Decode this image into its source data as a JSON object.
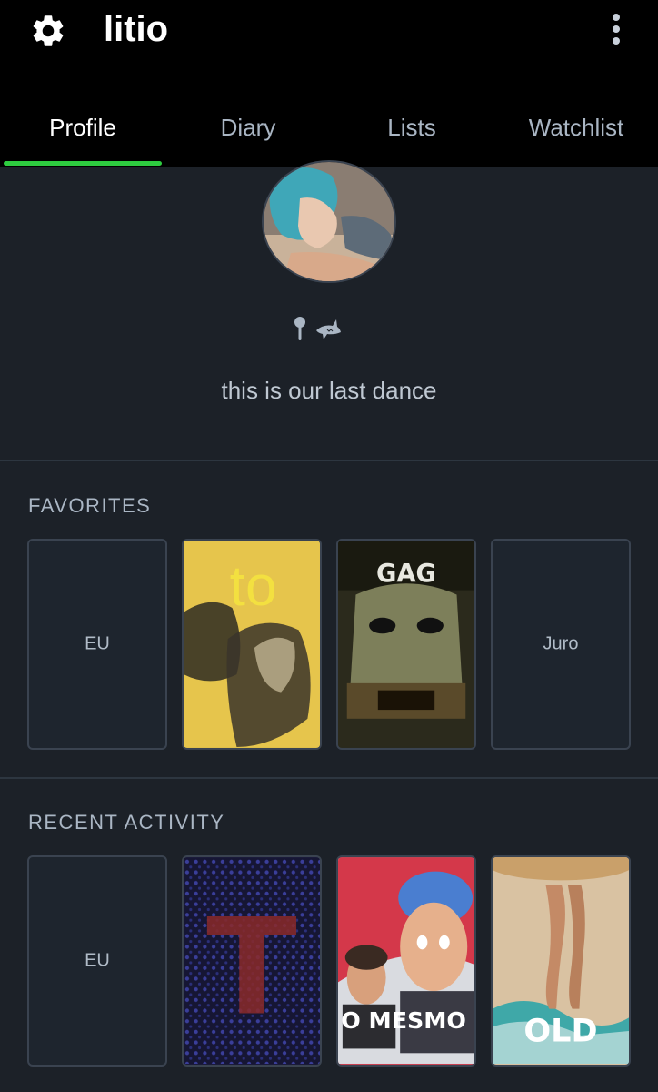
{
  "header": {
    "title": "litio",
    "settings_icon": "gear-icon",
    "menu_icon": "more-vert-icon"
  },
  "tabs": [
    {
      "label": "Profile",
      "active": true
    },
    {
      "label": "Diary",
      "active": false
    },
    {
      "label": "Lists",
      "active": false
    },
    {
      "label": "Watchlist",
      "active": false
    }
  ],
  "profile": {
    "avatar_icon": "avatar",
    "location_icon": "location-pin-icon",
    "emoji_icon": "shark-icon",
    "bio": "this is our last dance"
  },
  "favorites": {
    "title": "FAVORITES",
    "items": [
      {
        "label": "EU"
      },
      {
        "poster_text": "to"
      },
      {
        "poster_text": "GAG"
      },
      {
        "label": "Juro"
      }
    ]
  },
  "recent_activity": {
    "title": "RECENT ACTIVITY",
    "items": [
      {
        "label": "EU"
      },
      {
        "poster_text": "T"
      },
      {
        "poster_text": "O MESMO"
      },
      {
        "poster_text": "OLD"
      }
    ]
  },
  "colors": {
    "background": "#1c2128",
    "header": "#000000",
    "accent": "#2ecc40",
    "text_muted": "#aab6c4"
  }
}
